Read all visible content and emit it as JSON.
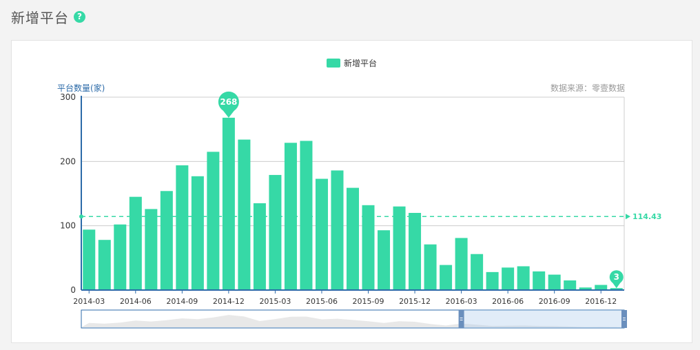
{
  "page": {
    "title": "新增平台",
    "help_icon": "question-circle-icon"
  },
  "colors": {
    "accent": "#36d9a6",
    "axis": "#2b6aa8",
    "grid": "#cccccc"
  },
  "chart_data": {
    "type": "bar",
    "legend": [
      "新增平台"
    ],
    "ylabel": "平台数量(家)",
    "source": "数据来源：零壹数据",
    "ylim": [
      0,
      300
    ],
    "yticks": [
      0,
      100,
      200,
      300
    ],
    "categories": [
      "2014-03",
      "2014-04",
      "2014-05",
      "2014-06",
      "2014-07",
      "2014-08",
      "2014-09",
      "2014-10",
      "2014-11",
      "2014-12",
      "2015-01",
      "2015-02",
      "2015-03",
      "2015-04",
      "2015-05",
      "2015-06",
      "2015-07",
      "2015-08",
      "2015-09",
      "2015-10",
      "2015-11",
      "2015-12",
      "2016-01",
      "2016-02",
      "2016-03",
      "2016-04",
      "2016-05",
      "2016-06",
      "2016-07",
      "2016-08",
      "2016-09",
      "2016-10",
      "2016-11",
      "2016-12",
      "2017-01"
    ],
    "xtick_labels": [
      "2014-03",
      "2014-06",
      "2014-09",
      "2014-12",
      "2015-03",
      "2015-06",
      "2015-09",
      "2015-12",
      "2016-03",
      "2016-06",
      "2016-09",
      "2016-12"
    ],
    "series": [
      {
        "name": "新增平台",
        "values": [
          94,
          78,
          102,
          145,
          126,
          154,
          194,
          177,
          215,
          268,
          234,
          135,
          179,
          229,
          232,
          173,
          186,
          159,
          132,
          93,
          130,
          120,
          71,
          39,
          81,
          56,
          28,
          35,
          37,
          29,
          24,
          15,
          4,
          8,
          3
        ]
      }
    ],
    "mark_points": [
      {
        "label": "268",
        "category": "2014-12",
        "value": 268
      },
      {
        "label": "3",
        "category": "2017-01",
        "value": 3
      }
    ],
    "mark_line": {
      "type": "average",
      "label": "114.43",
      "value": 114.43
    },
    "data_zoom": {
      "start": 0.7,
      "end": 1.0
    }
  }
}
